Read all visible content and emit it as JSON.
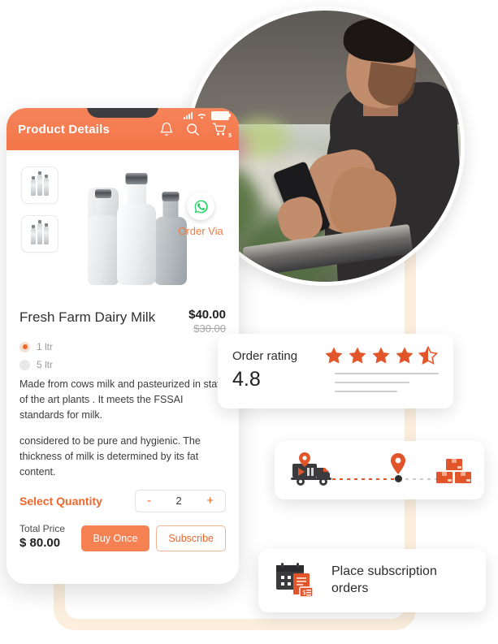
{
  "phone": {
    "header": {
      "title": "Product Details",
      "icons": [
        "bell-icon",
        "search-icon",
        "cart-icon"
      ],
      "cart_badge": "5",
      "status_icons": [
        "signal-icon",
        "wifi-icon",
        "battery-icon"
      ]
    },
    "order_via": {
      "icon": "whatsapp-icon",
      "label": "Order Via"
    },
    "product": {
      "title": "Fresh Farm Dairy Milk",
      "price_current": "$40.00",
      "price_old": "$30.00",
      "variants": [
        {
          "label": "1 ltr",
          "selected": true
        },
        {
          "label": "5 ltr",
          "selected": false
        }
      ],
      "description_paragraphs": [
        "Made from cows milk and pasteurized in state of the art plants . It meets the FSSAI standards for milk.",
        "considered to be pure and hygienic. The thickness of milk is determined by its fat content."
      ],
      "thumbnails": [
        "milk-bottles-thumb-1",
        "milk-bottles-thumb-2"
      ],
      "main_image": "milk-bottles-image"
    },
    "quantity": {
      "label": "Select Quantity",
      "decrement": "-",
      "value": "2",
      "increment": "+"
    },
    "checkout": {
      "total_label": "Total Price",
      "total_value": "$ 80.00",
      "buy_label": "Buy Once",
      "subscribe_label": "Subscribe"
    }
  },
  "rating_card": {
    "label": "Order rating",
    "value": "4.8",
    "stars_filled": 4,
    "stars_half": 1,
    "stars_total": 5
  },
  "tracking_card": {
    "icons": [
      "delivery-truck-icon",
      "map-pin-icon",
      "packages-icon"
    ]
  },
  "subscription_card": {
    "icon": "calendar-invoice-icon",
    "text_line1": "Place subscription",
    "text_line2": "orders"
  },
  "colors": {
    "accent": "#f0662a",
    "accent_light": "#f68254",
    "header": "#f47549",
    "cream": "#fbeedd",
    "star": "#e2542a"
  }
}
